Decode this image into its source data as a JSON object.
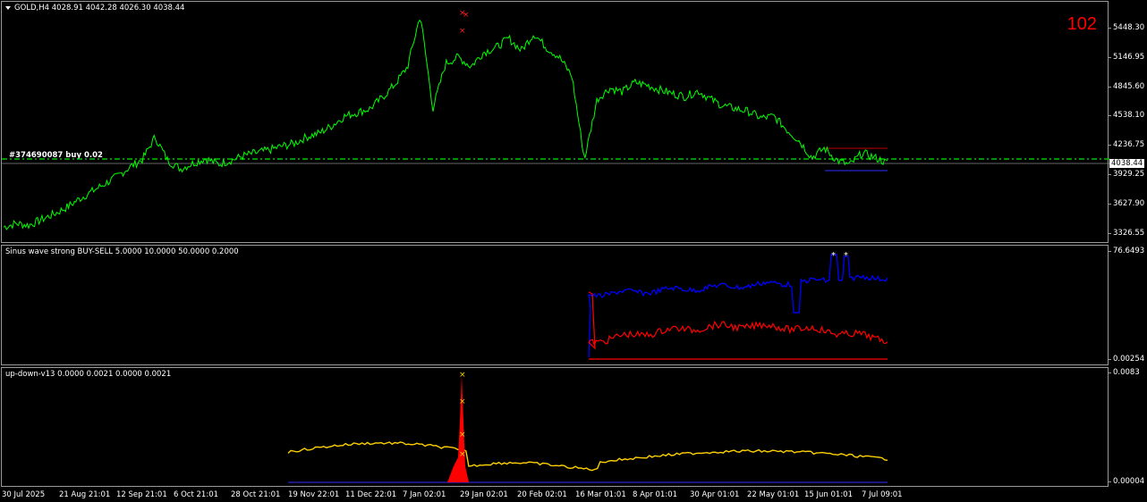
{
  "symbol_header": "GOLD,H4  4028.91 4042.28 4026.30 4038.44",
  "counter": "102",
  "order_label": "#374690087 buy 0.02",
  "current_price": "4038.44",
  "main_axis": [
    "5448.30",
    "5146.95",
    "4845.60",
    "4538.10",
    "4236.75",
    "3929.25",
    "3627.90",
    "3326.55"
  ],
  "sinus": {
    "label": "Sinus wave strong BUY-SELL 5.0000 10.0000 50.0000 0.2000",
    "axis_top": "76.6493",
    "axis_bottom": "0.00254"
  },
  "updown": {
    "label": "up-down-v13 0.0000 0.0021 0.0000 0.0021",
    "axis_top": "0.0083",
    "axis_bottom": "0.00004"
  },
  "time_labels": [
    "30 Jul 2025",
    "21 Aug 21:01",
    "12 Sep 21:01",
    "6 Oct 21:01",
    "28 Oct 21:01",
    "19 Nov 22:01",
    "11 Dec 22:01",
    "7 Jan 02:01",
    "29 Jan 02:01",
    "20 Feb 02:01",
    "16 Mar 01:01",
    "8 Apr 01:01",
    "30 Apr 01:01",
    "22 May 01:01",
    "15 Jun 01:01",
    "7 Jul 09:01"
  ],
  "colors": {
    "price_line": "#00ff00",
    "blue_line": "#0000ff",
    "red_line": "#ff0000",
    "yellow_line": "#ffd000",
    "level_line": "#00c000"
  },
  "price_series": [
    3340,
    3380,
    3360,
    3420,
    3480,
    3550,
    3640,
    3720,
    3800,
    3880,
    3980,
    4060,
    4300,
    4050,
    3960,
    4020,
    4070,
    4010,
    4050,
    4100,
    4130,
    4160,
    4200,
    4230,
    4300,
    4340,
    4420,
    4520,
    4560,
    4600,
    4720,
    4860,
    5050,
    5600,
    4600,
    5080,
    5150,
    5050,
    5200,
    5250,
    5350,
    5220,
    5400,
    5250,
    5150,
    4950,
    4060,
    4700,
    4820,
    4780,
    4880,
    4850,
    4800,
    4760,
    4730,
    4790,
    4700,
    4630,
    4600,
    4570,
    4500,
    4520,
    4380,
    4260,
    4080,
    4180,
    4050,
    4000,
    4130,
    4080,
    4020
  ]
}
